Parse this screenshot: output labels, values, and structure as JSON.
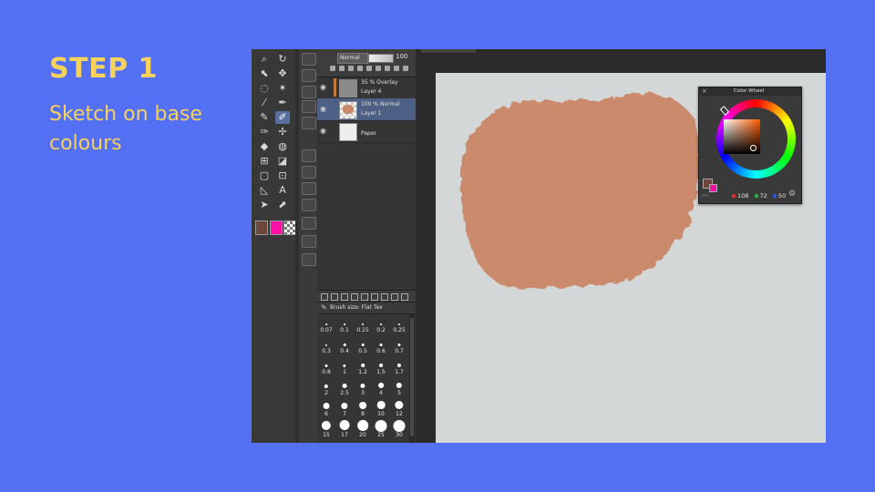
{
  "slide": {
    "title": "STEP 1",
    "description": "Sketch on base colours",
    "background_color": "#5470f5",
    "text_color": "#f7d25c"
  },
  "toolbox": {
    "tools": [
      {
        "icon": "zoom-icon",
        "glyph": "⌕"
      },
      {
        "icon": "rotate-icon",
        "glyph": "↻"
      },
      {
        "icon": "object-select-icon",
        "glyph": "⬉"
      },
      {
        "icon": "move-icon",
        "glyph": "✥"
      },
      {
        "icon": "lasso-icon",
        "glyph": "◌"
      },
      {
        "icon": "magic-wand-icon",
        "glyph": "✶"
      },
      {
        "icon": "eyedropper-icon",
        "glyph": "⁄"
      },
      {
        "icon": "pen-icon",
        "glyph": "✒"
      },
      {
        "icon": "pencil-icon",
        "glyph": "✎"
      },
      {
        "icon": "brush-icon",
        "glyph": "✐",
        "active": true
      },
      {
        "icon": "airbrush-icon",
        "glyph": "✑"
      },
      {
        "icon": "decoration-icon",
        "glyph": "✢"
      },
      {
        "icon": "eraser-icon",
        "glyph": "◆"
      },
      {
        "icon": "blend-icon",
        "glyph": "◍"
      },
      {
        "icon": "fill-icon",
        "glyph": "⊞"
      },
      {
        "icon": "gradient-icon",
        "glyph": "◪"
      },
      {
        "icon": "figure-icon",
        "glyph": "▢"
      },
      {
        "icon": "frame-icon",
        "glyph": "⊡"
      },
      {
        "icon": "ruler-icon",
        "glyph": "◺"
      },
      {
        "icon": "text-icon",
        "glyph": "A"
      },
      {
        "icon": "balloon-icon",
        "glyph": "➤"
      },
      {
        "icon": "correct-line-icon",
        "glyph": "⬈"
      }
    ],
    "main_color": "#6c483a",
    "sub_color": "#ff0fa4"
  },
  "layers_panel": {
    "blend_mode": "Normal",
    "opacity": "100",
    "layers": [
      {
        "top": "35 % Overlay",
        "name": "Layer 4",
        "thumb": "overlay"
      },
      {
        "top": "100 % Normal",
        "name": "Layer 1",
        "thumb": "layer1",
        "selected": true
      },
      {
        "top": "",
        "name": "Paper",
        "thumb": "paper"
      }
    ]
  },
  "brush_panel": {
    "title": "Brush size: Flat Tex",
    "sizes": [
      [
        "0.07",
        "0.1",
        "0.15",
        "0.2",
        "0.25"
      ],
      [
        "0.3",
        "0.4",
        "0.5",
        "0.6",
        "0.7"
      ],
      [
        "0.8",
        "1",
        "1.2",
        "1.5",
        "1.7"
      ],
      [
        "2",
        "2.5",
        "3",
        "4",
        "5"
      ],
      [
        "6",
        "7",
        "8",
        "10",
        "12"
      ],
      [
        "15",
        "17",
        "20",
        "25",
        "30"
      ]
    ]
  },
  "color_wheel": {
    "title": "Color Wheel",
    "r": "108",
    "g": "72",
    "b": "50",
    "r_color": "#e03030",
    "g_color": "#30b040",
    "b_color": "#3050e0"
  },
  "canvas": {
    "paper_color": "#d4d7d7",
    "paint_color": "#cc8a6c"
  }
}
